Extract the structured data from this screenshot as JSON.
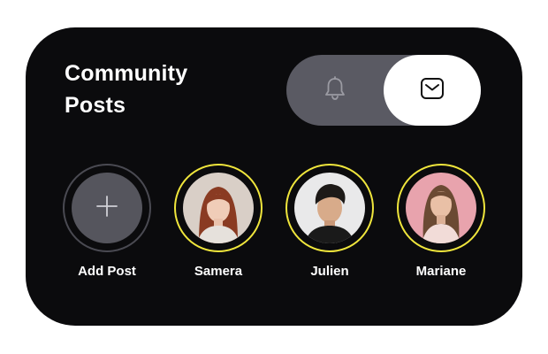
{
  "card": {
    "title": "Community Posts"
  },
  "toggle": {
    "options": [
      {
        "icon": "bell-icon",
        "selected": false
      },
      {
        "icon": "inbox-icon",
        "selected": true
      }
    ]
  },
  "stories": [
    {
      "label": "Add Post",
      "type": "add",
      "icon": "plus-icon"
    },
    {
      "label": "Samera",
      "type": "user",
      "icon": "avatar-samera",
      "bg": "#d9cfc7",
      "hair": "#8a3b22",
      "skin": "#f0cdb8",
      "clothes": "#e6e1dc"
    },
    {
      "label": "Julien",
      "type": "user",
      "icon": "avatar-julien",
      "bg": "#e9e9ea",
      "hair": "#1d1a18",
      "skin": "#d8ab8a",
      "clothes": "#1a1a1a"
    },
    {
      "label": "Mariane",
      "type": "user",
      "icon": "avatar-mariane",
      "bg": "#e8a3ad",
      "hair": "#6b4a33",
      "skin": "#e9c0a6",
      "clothes": "#f2dcd8"
    }
  ],
  "colors": {
    "card_bg": "#0b0b0d",
    "toggle_bg": "#5a5a63",
    "ring_active": "#f0e63c",
    "ring_add": "#4a4a52"
  }
}
